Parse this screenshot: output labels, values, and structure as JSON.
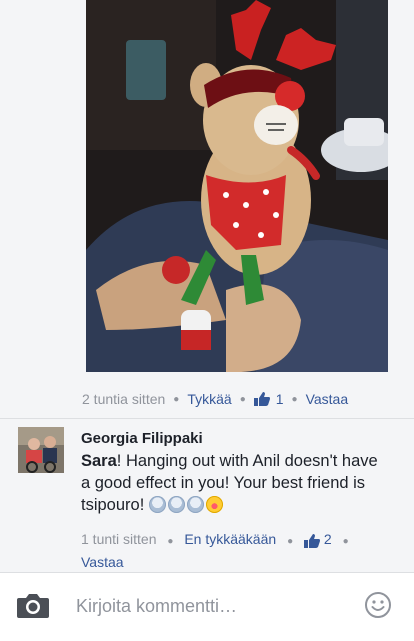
{
  "photo_comment": {
    "photo_alt": "reindeer plush toy",
    "time": "2 tuntia sitten",
    "like_label": "Tykkää",
    "like_count": "1",
    "reply_label": "Vastaa"
  },
  "comment": {
    "author": "Georgia Filippaki",
    "mention": "Sara",
    "text": "! Hanging out with Anil doesn't have a good effect in you! Your best friend is tsipouro! ",
    "emojis": [
      "worried-face",
      "worried-face",
      "worried-face",
      "winking-tongue-face"
    ],
    "time": "1 tunti sitten",
    "like_label": "En tykkääkään",
    "like_count": "2",
    "reply_label": "Vastaa"
  },
  "composer": {
    "placeholder": "Kirjoita kommentti…",
    "camera_icon": "camera-icon",
    "emoji_icon": "smiley-icon"
  },
  "colors": {
    "link": "#365899",
    "meta": "#90949c",
    "text": "#1d2129",
    "background": "#f4f5f7"
  }
}
